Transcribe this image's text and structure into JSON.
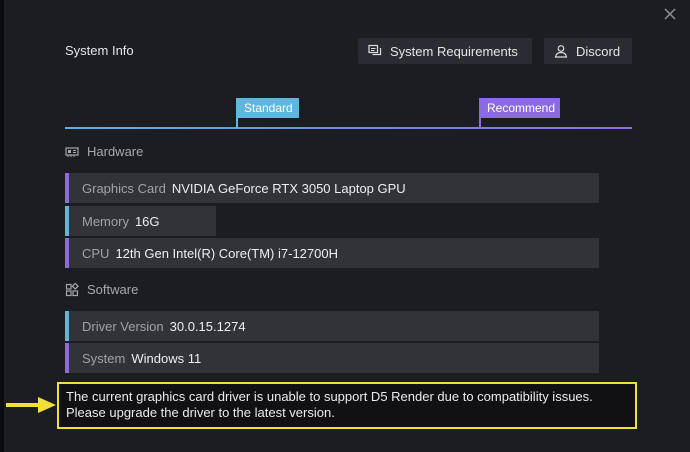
{
  "dialog": {
    "title": "System Info",
    "close_icon": "close-icon"
  },
  "buttons": {
    "system_requirements": {
      "label": "System Requirements",
      "icon": "document-chat-icon"
    },
    "discord": {
      "label": "Discord",
      "icon": "user-icon"
    }
  },
  "tiers": {
    "standard": "Standard",
    "recommend": "Recommend",
    "colors": {
      "standard": "#5fb6df",
      "recommend": "#8b6ae2"
    }
  },
  "hardware": {
    "heading": "Hardware",
    "icon": "gpu-card-icon",
    "rows": [
      {
        "label": "Graphics Card",
        "value": "NVIDIA GeForce RTX 3050 Laptop GPU",
        "tier": "recommend"
      },
      {
        "label": "Memory",
        "value": "16G",
        "tier": "standard"
      },
      {
        "label": "CPU",
        "value": "12th Gen Intel(R) Core(TM) i7-12700H",
        "tier": "recommend"
      }
    ]
  },
  "software": {
    "heading": "Software",
    "icon": "apps-grid-icon",
    "rows": [
      {
        "label": "Driver Version",
        "value": "30.0.15.1274",
        "tier": "standard"
      },
      {
        "label": "System",
        "value": "Windows 11",
        "tier": "recommend"
      }
    ]
  },
  "warning": {
    "line1": "The current graphics card driver is unable to support D5 Render due to compatibility issues.",
    "line2": "Please upgrade the driver to the latest version.",
    "highlight_color": "#f1e03a"
  }
}
